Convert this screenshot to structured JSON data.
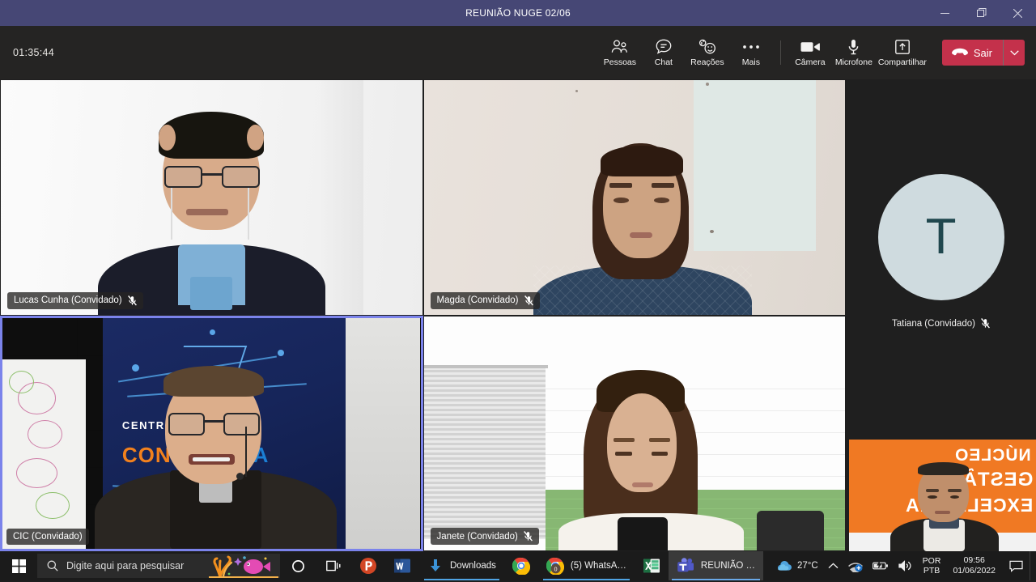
{
  "window": {
    "title": "REUNIÃO NUGE 02/06",
    "controls": [
      {
        "name": "minimize",
        "glyph": "minimize-icon"
      },
      {
        "name": "restore",
        "glyph": "restore-icon"
      },
      {
        "name": "close",
        "glyph": "close-icon"
      }
    ]
  },
  "toolbar": {
    "timer": "01:35:44",
    "items": [
      {
        "id": "pessoas",
        "label": "Pessoas",
        "icon": "people-icon"
      },
      {
        "id": "chat",
        "label": "Chat",
        "icon": "chat-icon"
      },
      {
        "id": "reacoes",
        "label": "Reações",
        "icon": "reactions-icon"
      },
      {
        "id": "mais",
        "label": "Mais",
        "icon": "more-icon"
      },
      {
        "id": "camera",
        "label": "Câmera",
        "icon": "camera-icon"
      },
      {
        "id": "microfone",
        "label": "Microfone",
        "icon": "microphone-icon"
      },
      {
        "id": "compartilhar",
        "label": "Compartilhar",
        "icon": "share-icon"
      }
    ],
    "leave_label": "Sair",
    "leave_icon": "hangup-icon",
    "leave_caret_icon": "chevron-down-icon",
    "leave_color": "#c4314b"
  },
  "stage": {
    "active_border_color": "#7b83eb",
    "tiles": [
      {
        "id": "lucas",
        "name": "Lucas Cunha (Convidado)",
        "muted": true,
        "active": false
      },
      {
        "id": "magda",
        "name": "Magda (Convidado)",
        "muted": true,
        "active": false
      },
      {
        "id": "cic",
        "name": "CIC (Convidado)",
        "muted": false,
        "active": true
      },
      {
        "id": "janete",
        "name": "Janete (Convidado)",
        "muted": true,
        "active": false
      }
    ],
    "rail": {
      "avatar": {
        "initial": "T",
        "name": "Tatiana (Convidado)",
        "muted": true,
        "bg_color": "#cfdbdf",
        "text_color": "#20474e"
      },
      "video_tile": {
        "id": "paulo",
        "banner_lines": [
          "NÚCLEO",
          "GESTÃO",
          "EXCELÊNCIA"
        ],
        "banner_color": "#f07923"
      }
    },
    "poster": {
      "line1": "CENTRO I",
      "line2a": "CONG",
      "line2b": "A",
      "color1": "#ffffff",
      "color2": "#f2811d",
      "color3": "#1b7fd4"
    }
  },
  "taskbar": {
    "start_icon": "windows-logo-icon",
    "search": {
      "placeholder": "Digite aqui para pesquisar",
      "icon": "search-icon",
      "decor": "fish-coral-icon"
    },
    "quick_icons": [
      {
        "id": "cortana",
        "icon": "cortana-circle-icon"
      },
      {
        "id": "taskview",
        "icon": "task-view-icon"
      }
    ],
    "apps": [
      {
        "id": "powerpoint",
        "label": "",
        "icon": "powerpoint-icon",
        "open": false,
        "focused": false
      },
      {
        "id": "word",
        "label": "",
        "icon": "word-icon",
        "open": false,
        "focused": false
      },
      {
        "id": "downloads",
        "label": "Downloads",
        "icon": "download-icon",
        "open": true,
        "focused": false
      },
      {
        "id": "chrome",
        "label": "",
        "icon": "chrome-icon",
        "open": false,
        "focused": false
      },
      {
        "id": "whatsapp",
        "label": "(5) WhatsA…",
        "icon": "chrome-icon",
        "open": true,
        "focused": false
      },
      {
        "id": "excel",
        "label": "",
        "icon": "excel-icon",
        "open": false,
        "focused": false
      },
      {
        "id": "teams",
        "label": "REUNIÃO …",
        "icon": "teams-icon",
        "open": true,
        "focused": true
      }
    ],
    "tray": {
      "weather_temp": "27°C",
      "weather_icon": "cloud-icon",
      "chevron_icon": "chevron-up-icon",
      "network_icon": "network-icon",
      "battery_icon": "battery-icon",
      "volume_icon": "volume-icon",
      "lang_line1": "POR",
      "lang_line2": "PTB",
      "time": "09:56",
      "date": "01/06/2022",
      "notification_icon": "notification-icon"
    }
  }
}
